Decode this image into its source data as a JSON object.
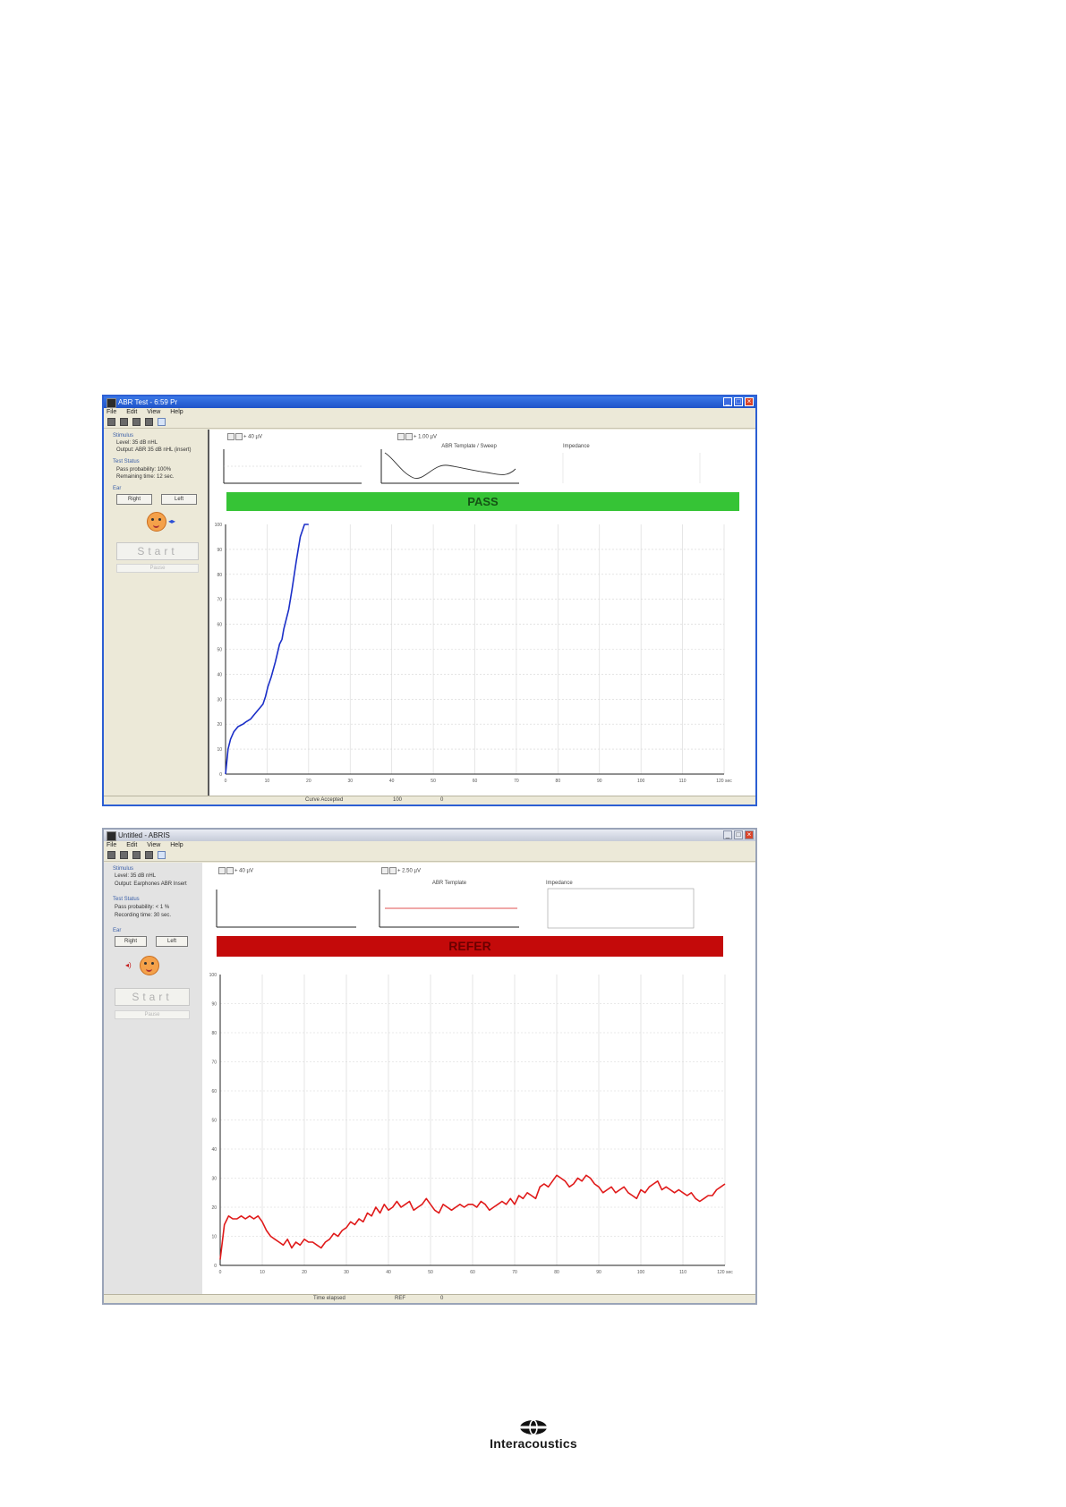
{
  "win1": {
    "title": "ABR Test - 6:59 Pr",
    "menu": [
      "File",
      "Edit",
      "View",
      "Help"
    ],
    "panel": {
      "stimulus_head": "Stimulus",
      "level": "Level: 35 dB nHL",
      "output": "Output: ABR 35 dB nHL (insert)",
      "test_status_head": "Test Status",
      "pass_prob": "Pass probability: 100%",
      "remaining": "Remaining time: 12 sec.",
      "ear_head": "Ear",
      "right_btn": "Right",
      "left_btn": "Left",
      "start": "Start",
      "pause": "Pause"
    },
    "ctl_left": "+ 40 µV",
    "ctl_mid": "+ 1.00 µV",
    "mini_title": "ABR Template / Sweep",
    "mini_right_title": "Impedance",
    "result": "PASS",
    "status": "Curve Accepted",
    "status_b": "100",
    "status_c": "0"
  },
  "win2": {
    "title": "Untitled - ABRIS",
    "menu": [
      "File",
      "Edit",
      "View",
      "Help"
    ],
    "panel": {
      "stimulus_head": "Stimulus",
      "level": "Level: 35 dB nHL",
      "output": "Output: Earphones ABR Insert",
      "test_status_head": "Test Status",
      "pass_prob": "Pass probability: < 1 %",
      "remaining": "Recording time: 30 sec.",
      "ear_head": "Ear",
      "right_btn": "Right",
      "left_btn": "Left",
      "start": "Start",
      "pause": "Pause"
    },
    "ctl_left": "+ 40 µV",
    "ctl_mid": "+ 2.50 µV",
    "mini_title": "ABR Template",
    "mini_right_title": "Impedance",
    "result": "REFER",
    "status": "Time elapsed",
    "status_b": "REF",
    "status_c": "0"
  },
  "logo_text": "Interacoustics",
  "chart_data": [
    {
      "type": "line",
      "name": "pass-probability-curve",
      "color": "#1b2fc8",
      "xlim": [
        0,
        120
      ],
      "ylim": [
        0,
        100
      ],
      "x_ticks": [
        0,
        10,
        20,
        30,
        40,
        50,
        60,
        70,
        80,
        90,
        100,
        110,
        "120 sec"
      ],
      "y_ticks": [
        0,
        10,
        20,
        30,
        40,
        50,
        60,
        70,
        80,
        90,
        100
      ],
      "x": [
        0,
        0.6,
        1.2,
        2,
        3,
        4.2,
        5,
        6,
        7,
        8,
        9,
        9.6,
        10.2,
        11,
        12,
        13,
        13.6,
        14,
        15.2,
        16,
        17,
        18,
        19,
        20
      ],
      "y": [
        0,
        10,
        14,
        17,
        19,
        20,
        21,
        22,
        24,
        26,
        28,
        31,
        35,
        39,
        45,
        52,
        54,
        58,
        66,
        74,
        85,
        95,
        100,
        100
      ]
    },
    {
      "type": "line",
      "name": "refer-curve",
      "color": "#e01a1a",
      "xlim": [
        0,
        120
      ],
      "ylim": [
        0,
        100
      ],
      "x_ticks": [
        0,
        10,
        20,
        30,
        40,
        50,
        60,
        70,
        80,
        90,
        100,
        110,
        "120 sec"
      ],
      "y_ticks": [
        0,
        10,
        20,
        30,
        40,
        50,
        60,
        70,
        80,
        90,
        100
      ],
      "x": [
        0,
        1,
        2,
        3,
        4,
        5,
        6,
        7,
        8,
        9,
        10,
        11,
        12,
        13,
        14,
        15,
        16,
        17,
        18,
        19,
        20,
        21,
        22,
        23,
        24,
        25,
        26,
        27,
        28,
        29,
        30,
        31,
        32,
        33,
        34,
        35,
        36,
        37,
        38,
        39,
        40,
        41,
        42,
        43,
        44,
        45,
        46,
        47,
        48,
        49,
        50,
        51,
        52,
        53,
        54,
        55,
        56,
        57,
        58,
        59,
        60,
        61,
        62,
        63,
        64,
        65,
        66,
        67,
        68,
        69,
        70,
        71,
        72,
        73,
        74,
        75,
        76,
        77,
        78,
        79,
        80,
        81,
        82,
        83,
        84,
        85,
        86,
        87,
        88,
        89,
        90,
        91,
        92,
        93,
        94,
        95,
        96,
        97,
        98,
        99,
        100,
        101,
        102,
        103,
        104,
        105,
        106,
        107,
        108,
        109,
        110,
        111,
        112,
        113,
        114,
        115,
        116,
        117,
        118,
        119,
        120
      ],
      "y": [
        2,
        14,
        17,
        16,
        16,
        17,
        16,
        17,
        16,
        17,
        15,
        12,
        10,
        9,
        8,
        7,
        9,
        6,
        8,
        7,
        9,
        8,
        8,
        7,
        6,
        8,
        9,
        11,
        10,
        12,
        13,
        15,
        14,
        16,
        15,
        18,
        17,
        20,
        18,
        21,
        19,
        20,
        22,
        20,
        21,
        22,
        19,
        20,
        21,
        23,
        21,
        19,
        18,
        21,
        20,
        19,
        20,
        21,
        20,
        21,
        21,
        20,
        22,
        21,
        19,
        20,
        21,
        22,
        21,
        23,
        21,
        24,
        23,
        25,
        24,
        23,
        27,
        28,
        27,
        29,
        31,
        30,
        29,
        27,
        28,
        30,
        29,
        31,
        30,
        28,
        27,
        25,
        26,
        27,
        25,
        26,
        27,
        25,
        24,
        23,
        26,
        25,
        27,
        28,
        29,
        26,
        27,
        26,
        25,
        26,
        25,
        24,
        25,
        23,
        22,
        23,
        24,
        24,
        26,
        27,
        28
      ]
    }
  ]
}
